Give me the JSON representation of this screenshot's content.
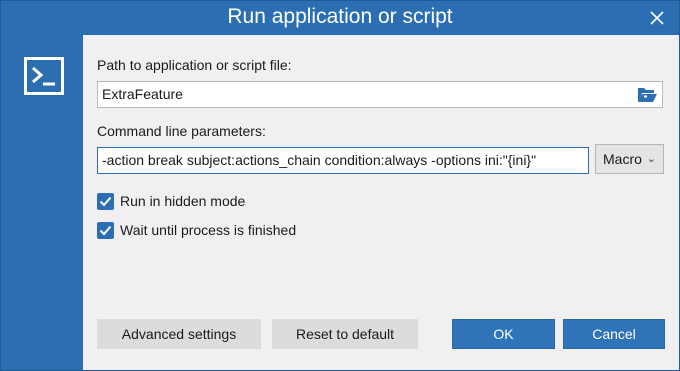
{
  "window": {
    "title": "Run application or script",
    "close_icon": "close-icon",
    "app_icon": "terminal-icon"
  },
  "path": {
    "label": "Path to application or script file:",
    "value": "ExtraFeature",
    "browse_icon": "folder-open-icon"
  },
  "params": {
    "label": "Command line parameters:",
    "value": "-action break subject:actions_chain condition:always -options ini:\"{ini}\"",
    "macro_label": "Macro",
    "macro_icon": "chevron-down-icon"
  },
  "options": [
    {
      "label": "Run in hidden mode",
      "checked": true
    },
    {
      "label": "Wait until process is finished",
      "checked": true
    }
  ],
  "buttons": {
    "advanced": "Advanced settings",
    "reset": "Reset to default",
    "ok": "OK",
    "cancel": "Cancel"
  },
  "colors": {
    "accent": "#2b6fb2",
    "panel_bg": "#f0f0f0",
    "ok_bg": "#2f73b8",
    "cancel_bg": "#2f73b8"
  }
}
